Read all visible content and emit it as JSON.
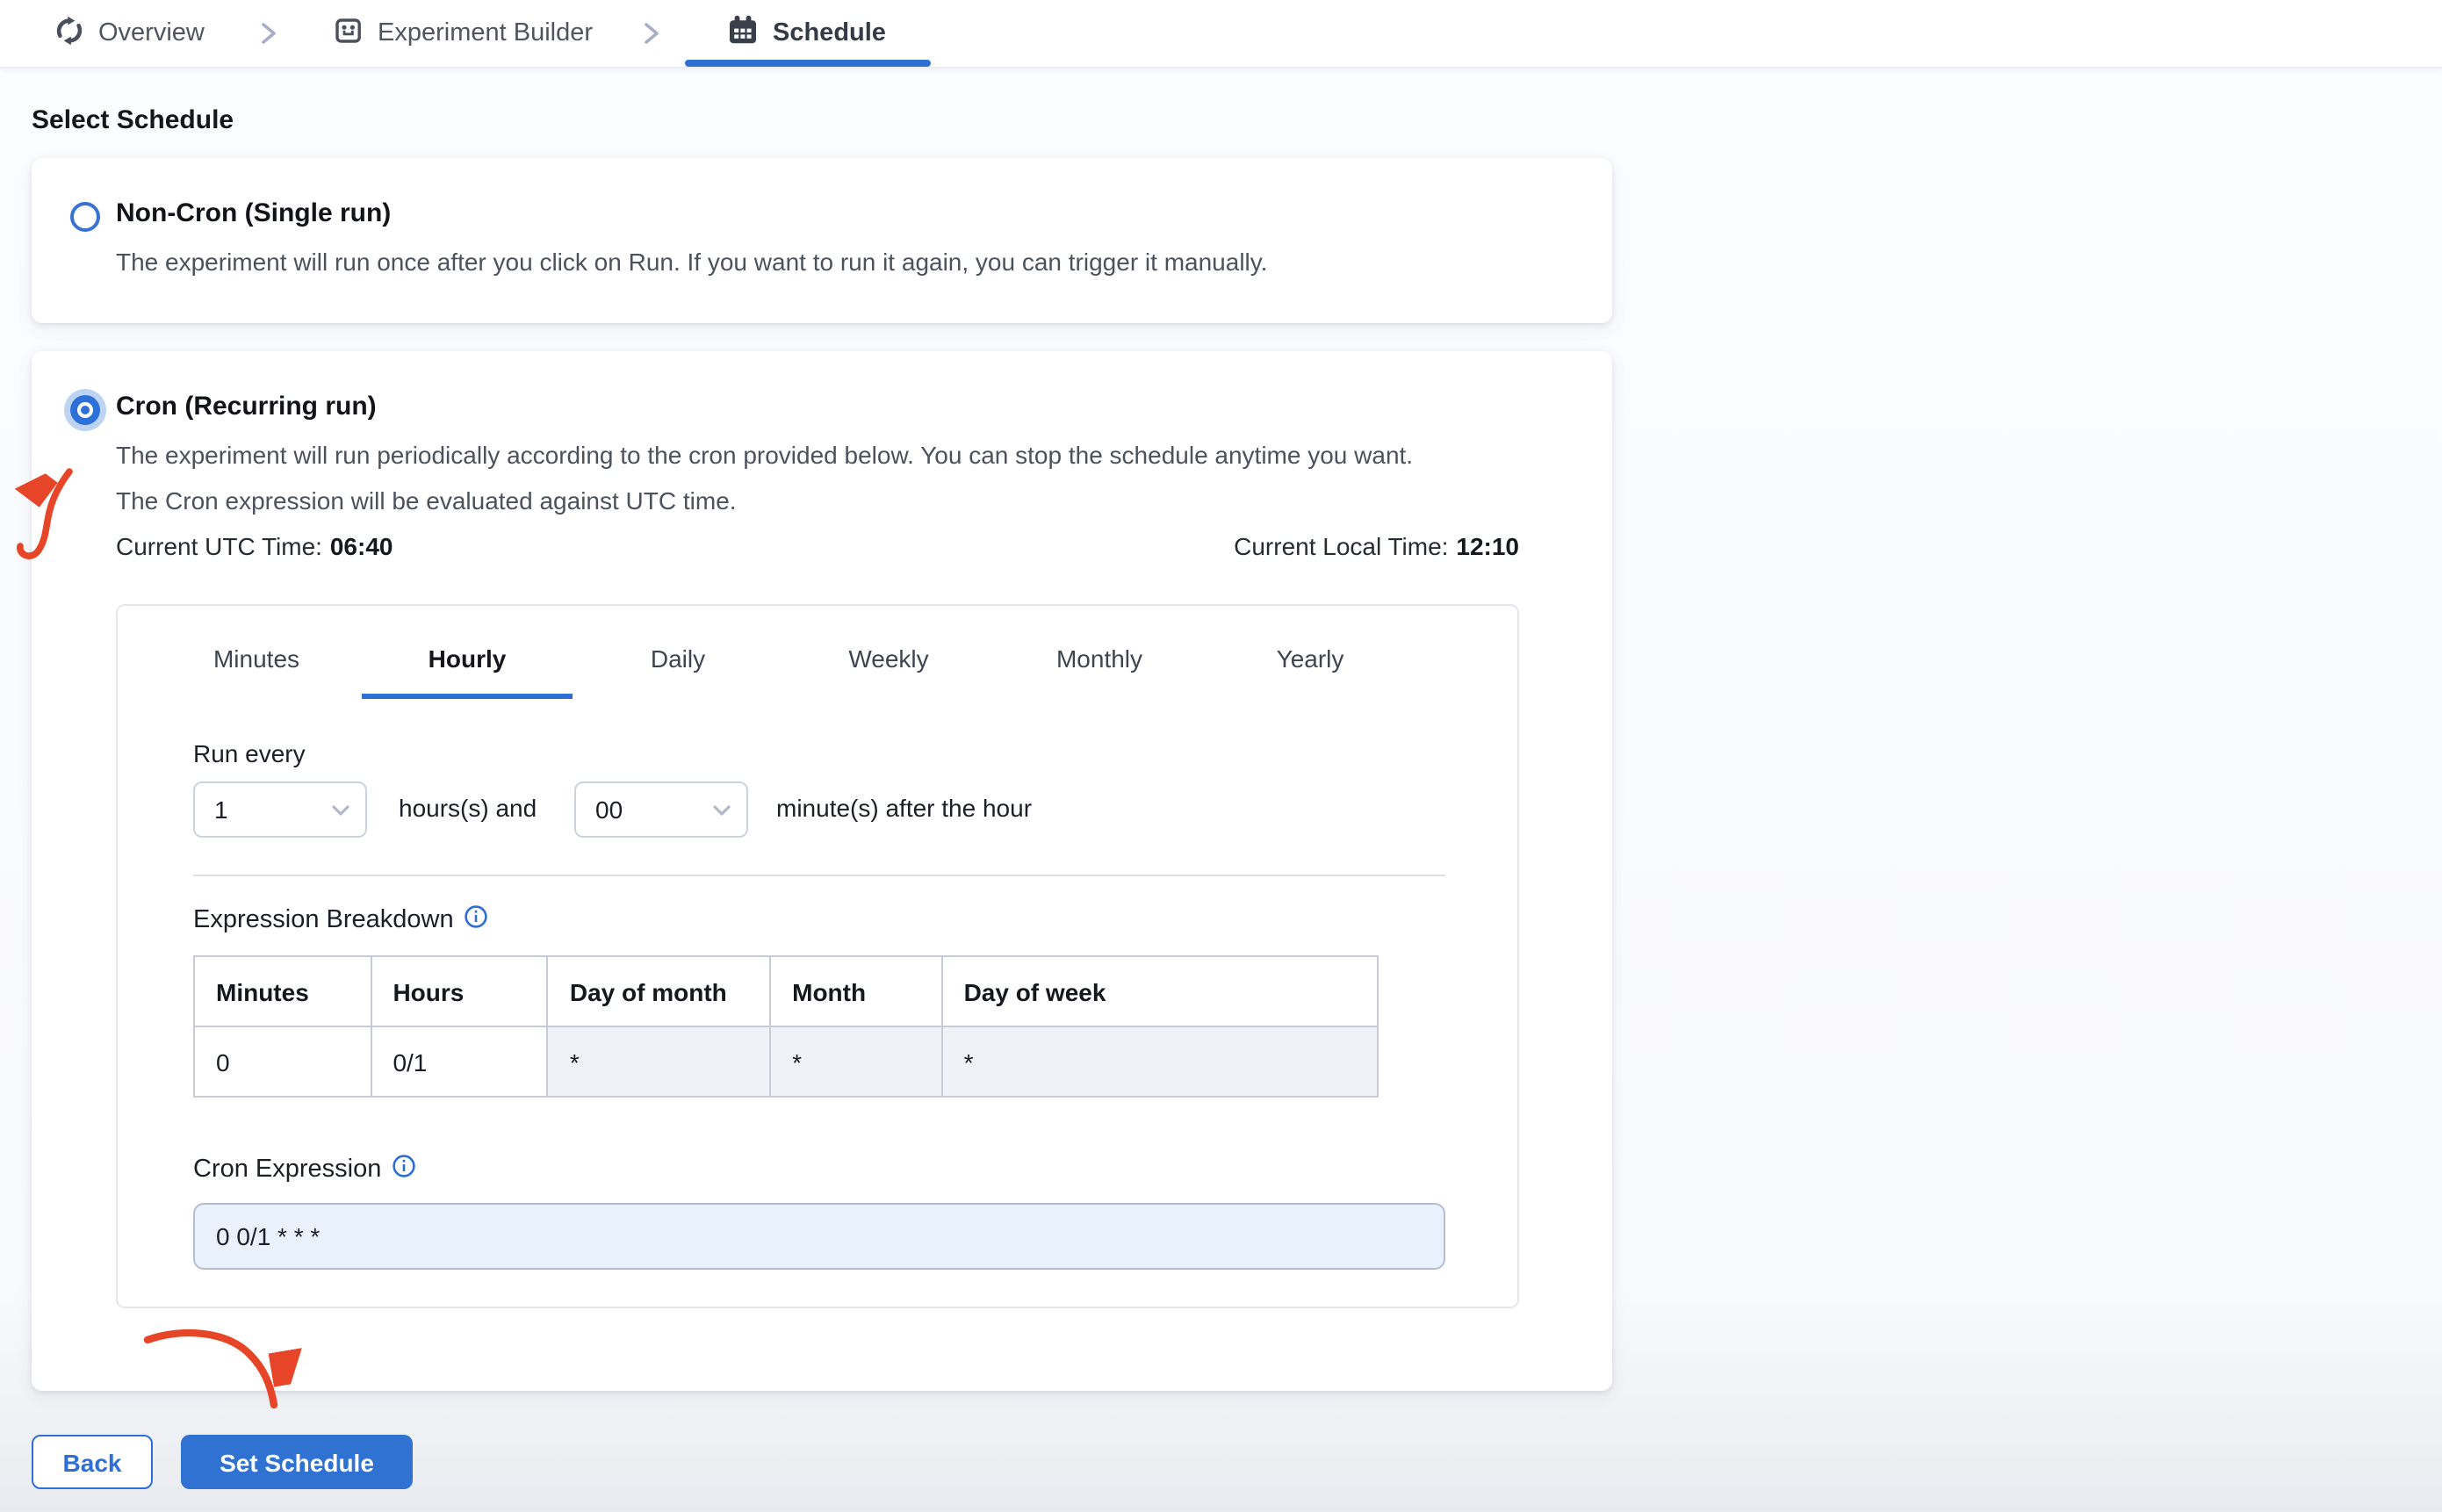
{
  "breadcrumb": {
    "items": [
      {
        "label": "Overview"
      },
      {
        "label": "Experiment Builder"
      },
      {
        "label": "Schedule"
      }
    ]
  },
  "page": {
    "heading": "Select Schedule"
  },
  "options": {
    "non_cron": {
      "title": "Non-Cron (Single run)",
      "description": "The experiment will run once after you click on Run. If you want to run it again, you can trigger it manually."
    },
    "cron": {
      "title": "Cron (Recurring run)",
      "description_line1": "The experiment will run periodically according to the cron provided below. You can stop the schedule anytime you want.",
      "description_line2": "The Cron expression will be evaluated against UTC time.",
      "utc_time_label": "Current UTC Time:",
      "utc_time_value": "06:40",
      "local_time_label": "Current Local Time:",
      "local_time_value": "12:10"
    }
  },
  "scheduler": {
    "tabs": [
      "Minutes",
      "Hourly",
      "Daily",
      "Weekly",
      "Monthly",
      "Yearly"
    ],
    "active_tab": "Hourly",
    "run_every_label": "Run every",
    "hours_value": "1",
    "hours_suffix": "hours(s) and",
    "minutes_value": "00",
    "minutes_suffix": "minute(s) after the hour",
    "breakdown": {
      "label": "Expression Breakdown",
      "headers": [
        "Minutes",
        "Hours",
        "Day of month",
        "Month",
        "Day of week"
      ],
      "values": [
        "0",
        "0/1",
        "*",
        "*",
        "*"
      ]
    },
    "cron": {
      "label": "Cron Expression",
      "value": "0 0/1 * * *"
    }
  },
  "footer": {
    "back_label": "Back",
    "set_schedule_label": "Set Schedule"
  },
  "colors": {
    "accent": "#2e6fd3",
    "arrow_red": "#e64527",
    "input_bg": "#e9f1fc",
    "disabled_cell": "#f1f1f8"
  }
}
